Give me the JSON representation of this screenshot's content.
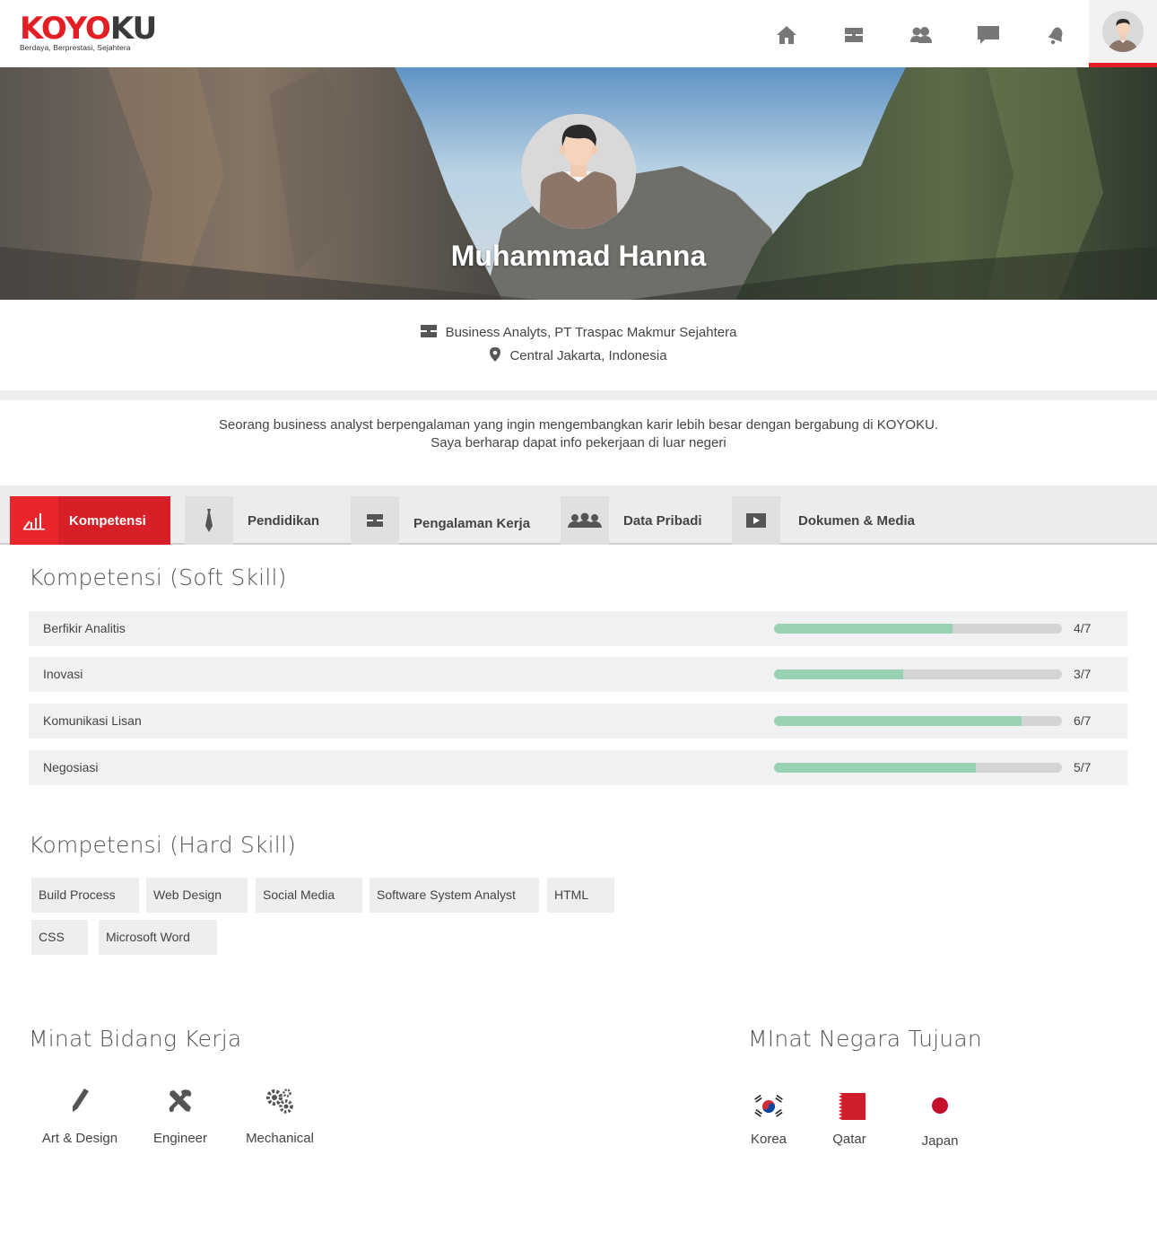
{
  "brand": {
    "name_red": "KOYO",
    "name_dark": "KU",
    "tagline": "Berdaya, Berprestasi, Sejahtera",
    "accent": "#e31e24"
  },
  "nav": {
    "icons": [
      "home-icon",
      "briefcase-icon",
      "people-icon",
      "chat-icon",
      "bell-icon"
    ],
    "avatar": "user-avatar"
  },
  "profile": {
    "name": "Muhammad Hanna",
    "job": "Business Analyts,  PT Traspac Makmur Sejahtera",
    "location": "Central Jakarta, Indonesia",
    "bio_line1": "Seorang business  analyst berpengalaman yang ingin mengembangkan karir lebih besar dengan bergabung di KOYOKU.",
    "bio_line2": "Saya berharap dapat info pekerjaan di luar negeri"
  },
  "tabs": [
    {
      "label": "Kompetensi",
      "icon": "chart-icon",
      "active": true
    },
    {
      "label": "Pendidikan",
      "icon": "tie-icon",
      "active": false
    },
    {
      "label": "Pengalaman Kerja",
      "icon": "briefcase-icon",
      "active": false
    },
    {
      "label": "Data Pribadi",
      "icon": "group-icon",
      "active": false
    },
    {
      "label": "Dokumen & Media",
      "icon": "play-icon",
      "active": false
    }
  ],
  "soft_skills": {
    "title": "Kompetensi (Soft Skill)",
    "bar_color": "#99d2b3",
    "items": [
      {
        "name": "Berfikir Analitis",
        "score": "4/7",
        "level": 0.62
      },
      {
        "name": "Inovasi",
        "score": "3/7",
        "level": 0.45
      },
      {
        "name": "Komunikasi Lisan",
        "score": "6/7",
        "level": 0.86
      },
      {
        "name": "Negosiasi",
        "score": "5/7",
        "level": 0.7
      }
    ]
  },
  "hard_skills": {
    "title": "Kompetensi (Hard Skill)",
    "items": [
      "Build Process",
      "Web Design",
      "Social Media",
      "Software System Analyst",
      "HTML",
      "CSS",
      "Microsoft Word"
    ]
  },
  "interests": {
    "title": "Minat Bidang Kerja",
    "items": [
      {
        "label": "Art & Design",
        "icon": "pencil-icon"
      },
      {
        "label": "Engineer",
        "icon": "tools-icon"
      },
      {
        "label": "Mechanical",
        "icon": "gears-icon"
      }
    ]
  },
  "countries": {
    "title": "MInat Negara Tujuan",
    "items": [
      {
        "label": "Korea",
        "icon": "korea-flag-icon"
      },
      {
        "label": "Qatar",
        "icon": "qatar-flag-icon"
      },
      {
        "label": "Japan",
        "icon": "japan-flag-icon"
      }
    ]
  }
}
